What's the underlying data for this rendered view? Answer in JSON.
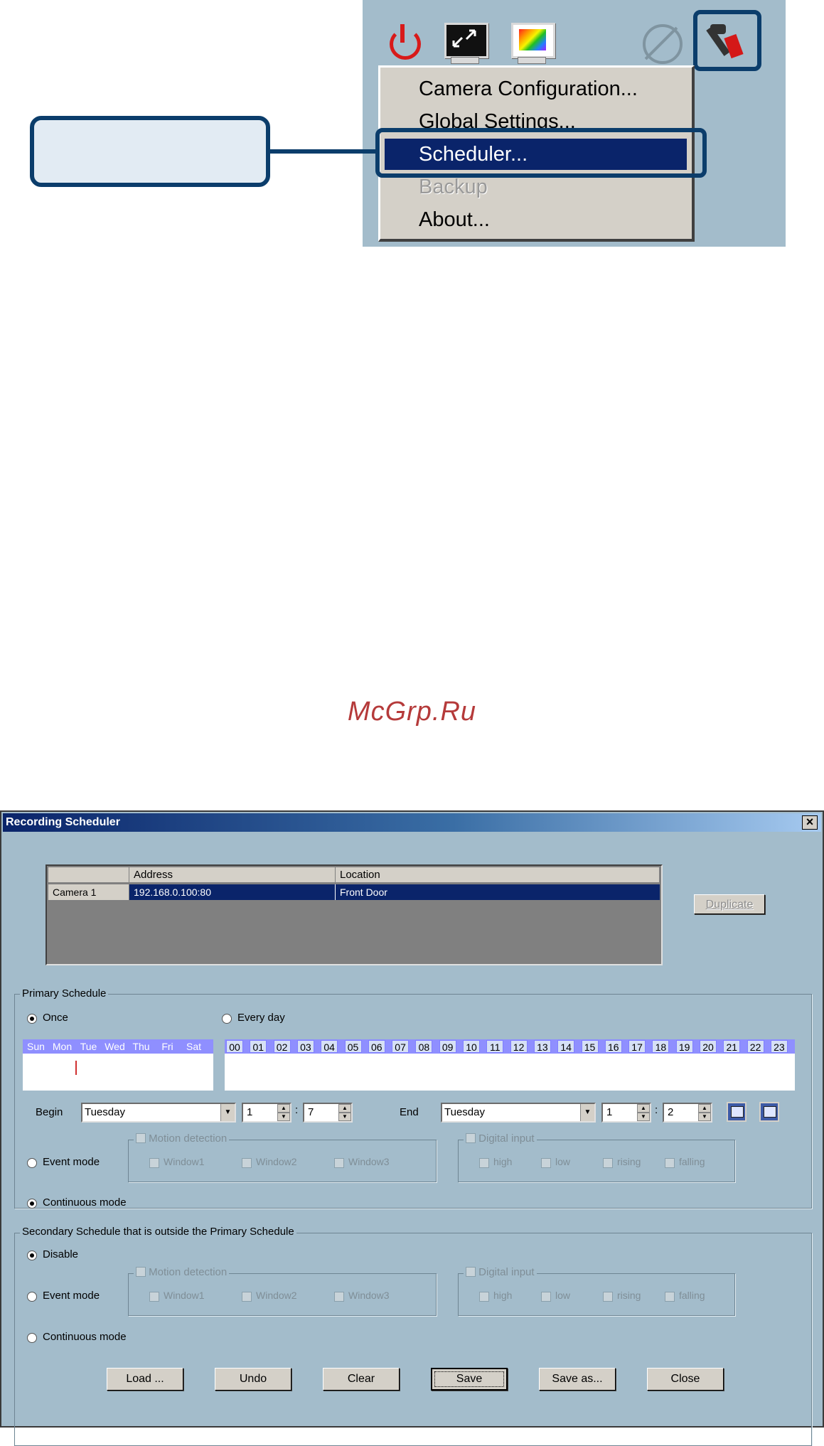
{
  "menu": {
    "items": [
      "Camera Configuration...",
      "Global Settings...",
      "Scheduler...",
      "Backup",
      "About..."
    ],
    "selected_index": 2,
    "disabled_index": 3
  },
  "watermark": "McGrp.Ru",
  "dialog": {
    "title": "Recording Scheduler",
    "close_label": "×",
    "table": {
      "columns": [
        "",
        "Address",
        "Location"
      ],
      "rows": [
        {
          "camera": "Camera  1",
          "address": "192.168.0.100:80",
          "location": "Front Door"
        }
      ]
    },
    "duplicate_label": "Duplicate",
    "primary": {
      "title": "Primary Schedule",
      "once_label": "Once",
      "everyday_label": "Every day",
      "days": [
        "Sun",
        "Mon",
        "Tue",
        "Wed",
        "Thu",
        "Fri",
        "Sat"
      ],
      "hours": [
        "00",
        "01",
        "02",
        "03",
        "04",
        "05",
        "06",
        "07",
        "08",
        "09",
        "10",
        "11",
        "12",
        "13",
        "14",
        "15",
        "16",
        "17",
        "18",
        "19",
        "20",
        "21",
        "22",
        "23"
      ],
      "begin_label": "Begin",
      "begin_day": "Tuesday",
      "begin_hour": "1",
      "begin_minute": "7",
      "end_label": "End",
      "end_day": "Tuesday",
      "end_hour": "1",
      "end_minute": "2",
      "event_label": "Event mode",
      "continuous_label": "Continuous mode",
      "motion_label": "Motion detection",
      "windows": [
        "Window1",
        "Window2",
        "Window3"
      ],
      "digital_label": "Digital input",
      "digital_opts": [
        "high",
        "low",
        "rising",
        "falling"
      ]
    },
    "secondary": {
      "title": "Secondary Schedule that is outside the Primary Schedule",
      "disable_label": "Disable",
      "event_label": "Event mode",
      "continuous_label": "Continuous mode",
      "motion_label": "Motion detection",
      "windows": [
        "Window1",
        "Window2",
        "Window3"
      ],
      "digital_label": "Digital input",
      "digital_opts": [
        "high",
        "low",
        "rising",
        "falling"
      ]
    },
    "buttons": [
      "Load ...",
      "Undo",
      "Clear",
      "Save",
      "Save as...",
      "Close"
    ]
  }
}
